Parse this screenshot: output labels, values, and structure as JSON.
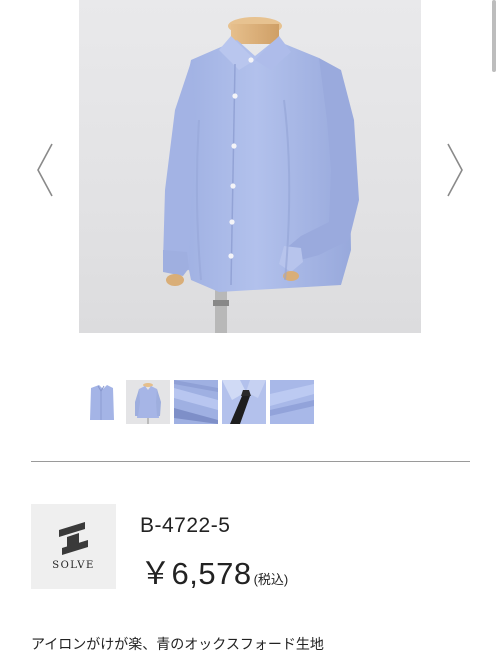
{
  "gallery": {
    "thumbnails": [
      {
        "name": "shirt-folded"
      },
      {
        "name": "shirt-full"
      },
      {
        "name": "fabric-closeup"
      },
      {
        "name": "shirt-with-tie"
      },
      {
        "name": "fabric-detail"
      }
    ]
  },
  "product": {
    "brand": "SOLVE",
    "sku": "B-4722-5",
    "price": "￥6,578",
    "tax_note": "(税込)",
    "description": "アイロンがけが楽、青のオックスフォード生地"
  },
  "colors": {
    "shirt": "#a9b9e8",
    "background": "#e6e6e8",
    "text": "#222222"
  }
}
